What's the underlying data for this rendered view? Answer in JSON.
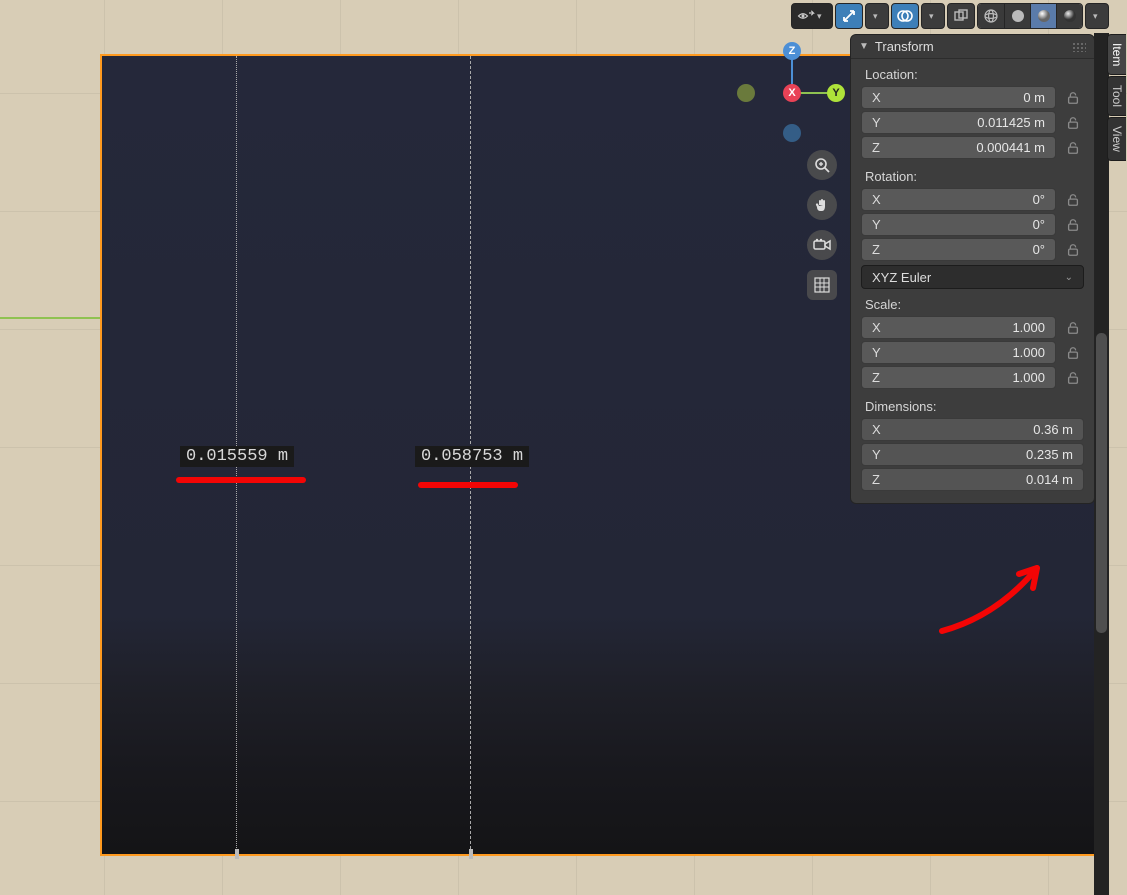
{
  "header": {
    "visibility_icon": "visibility-icon",
    "gizmo_icon": "gizmo-icon",
    "overlay_icon": "overlay-icon",
    "xray_icon": "xray-icon",
    "shading_labels": [
      "wireframe",
      "solid",
      "matcap",
      "rendered"
    ]
  },
  "side_tabs": [
    "Item",
    "Tool",
    "View"
  ],
  "active_side_tab": "Item",
  "transform": {
    "title": "Transform",
    "location": {
      "label": "Location:",
      "x": {
        "axis": "X",
        "value": "0 m"
      },
      "y": {
        "axis": "Y",
        "value": "0.011425 m"
      },
      "z": {
        "axis": "Z",
        "value": "0.000441 m"
      }
    },
    "rotation": {
      "label": "Rotation:",
      "x": {
        "axis": "X",
        "value": "0°"
      },
      "y": {
        "axis": "Y",
        "value": "0°"
      },
      "z": {
        "axis": "Z",
        "value": "0°"
      },
      "order": "XYZ Euler"
    },
    "scale": {
      "label": "Scale:",
      "x": {
        "axis": "X",
        "value": "1.000"
      },
      "y": {
        "axis": "Y",
        "value": "1.000"
      },
      "z": {
        "axis": "Z",
        "value": "1.000"
      }
    },
    "dimensions": {
      "label": "Dimensions:",
      "x": {
        "axis": "X",
        "value": "0.36 m"
      },
      "y": {
        "axis": "Y",
        "value": "0.235 m"
      },
      "z": {
        "axis": "Z",
        "value": "0.014 m"
      }
    }
  },
  "gizmo": {
    "x": "X",
    "y": "Y",
    "z": "Z"
  },
  "viewport": {
    "measure1": "0.015559 m",
    "measure2": "0.058753 m"
  },
  "view_buttons": [
    "zoom",
    "pan",
    "camera",
    "grid-overlay"
  ]
}
